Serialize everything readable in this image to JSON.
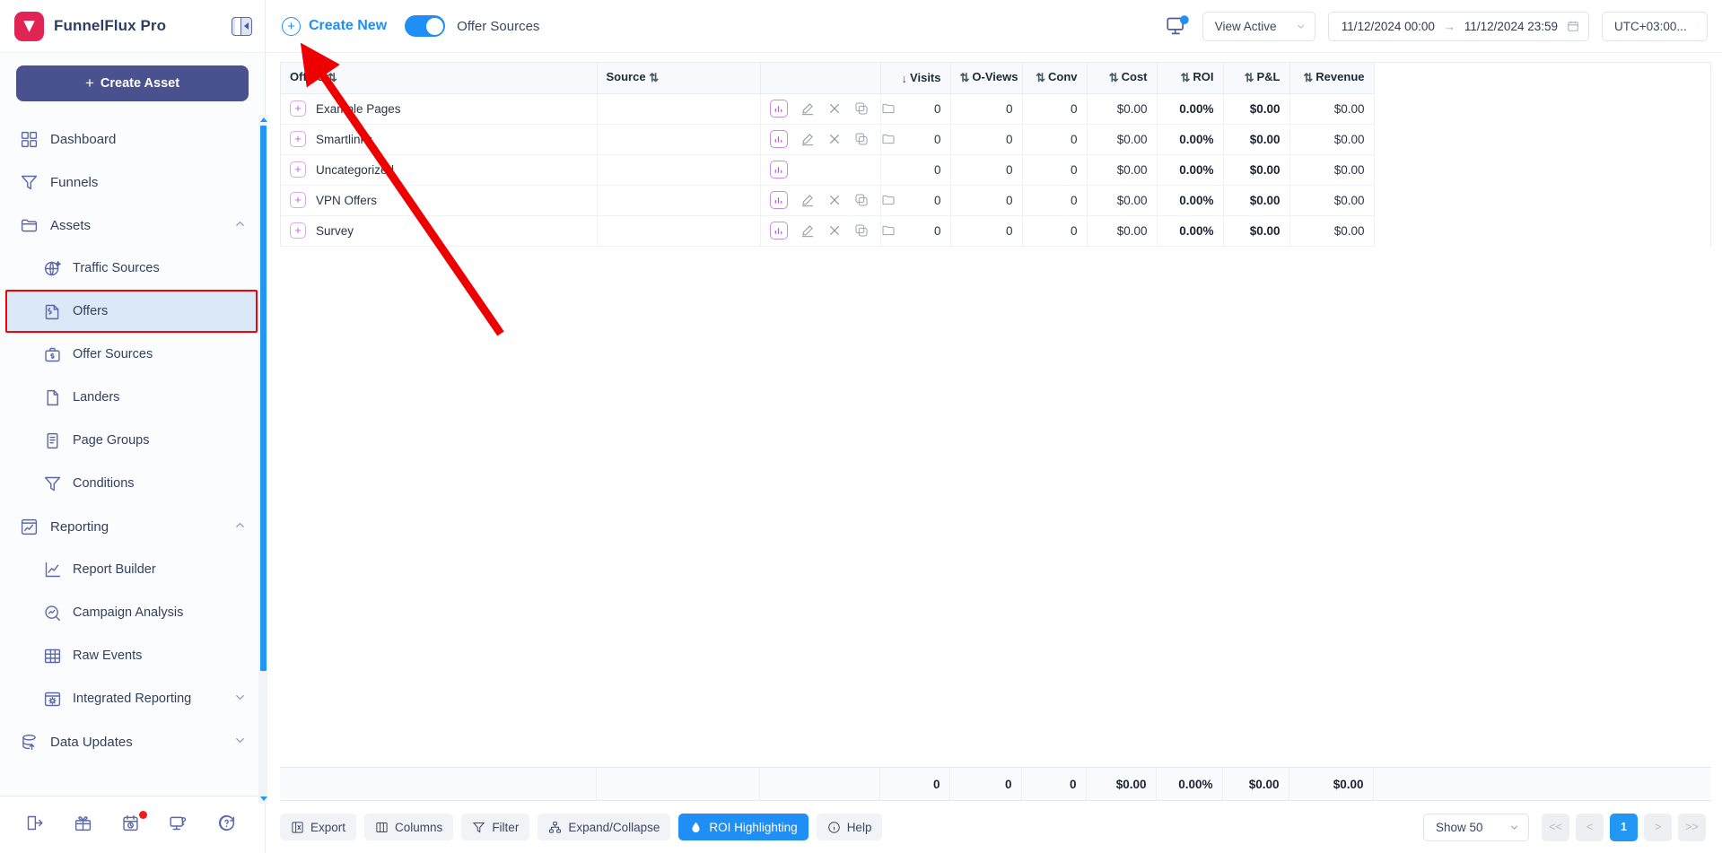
{
  "app": {
    "brand_title": "FunnelFlux Pro",
    "collapse_icon": "panel-collapse-icon",
    "create_asset_label": "Create Asset"
  },
  "sidebar": {
    "items": [
      {
        "label": "Dashboard",
        "icon": "dashboard-grid-icon",
        "level": "top",
        "active": false,
        "chevron": false
      },
      {
        "label": "Funnels",
        "icon": "funnel-icon",
        "level": "top",
        "active": false,
        "chevron": false
      },
      {
        "label": "Assets",
        "icon": "folder-icon",
        "level": "top",
        "active": false,
        "chevron": true
      },
      {
        "label": "Traffic Sources",
        "icon": "globe-sparkle-icon",
        "level": "sub",
        "active": false,
        "chevron": false
      },
      {
        "label": "Offers",
        "icon": "offer-dollar-doc-icon",
        "level": "sub",
        "active": true,
        "chevron": false
      },
      {
        "label": "Offer Sources",
        "icon": "briefcase-dollar-icon",
        "level": "sub",
        "active": false,
        "chevron": false
      },
      {
        "label": "Landers",
        "icon": "page-icon",
        "level": "sub",
        "active": false,
        "chevron": false
      },
      {
        "label": "Page Groups",
        "icon": "page-stack-icon",
        "level": "sub",
        "active": false,
        "chevron": false
      },
      {
        "label": "Conditions",
        "icon": "filter-funnel-icon",
        "level": "sub",
        "active": false,
        "chevron": false
      },
      {
        "label": "Reporting",
        "icon": "report-chart-icon",
        "level": "top",
        "active": false,
        "chevron": true
      },
      {
        "label": "Report Builder",
        "icon": "line-chart-icon",
        "level": "sub",
        "active": false,
        "chevron": false
      },
      {
        "label": "Campaign Analysis",
        "icon": "magnifier-chart-icon",
        "level": "sub",
        "active": false,
        "chevron": false
      },
      {
        "label": "Raw Events",
        "icon": "table-grid-icon",
        "level": "sub",
        "active": false,
        "chevron": false
      },
      {
        "label": "Integrated Reporting",
        "icon": "window-gear-icon",
        "level": "sub",
        "active": false,
        "chevron": true
      },
      {
        "label": "Data Updates",
        "icon": "database-upload-icon",
        "level": "top",
        "active": false,
        "chevron": true
      }
    ],
    "footer_icons": [
      {
        "name": "logout-icon",
        "badge": false
      },
      {
        "name": "gift-icon",
        "badge": false
      },
      {
        "name": "calendar-clock-icon",
        "badge": true
      },
      {
        "name": "monitor-question-icon",
        "badge": false
      },
      {
        "name": "help-chat-icon",
        "badge": false
      }
    ],
    "active_highlight_color": "#fa0000"
  },
  "topbar": {
    "create_new_label": "Create New",
    "create_new_icon": "plus-circle-icon",
    "toggle_label": "Offer Sources",
    "toggle_on": true,
    "monitor_icon": "monitor-refresh-icon",
    "view_select": "View Active",
    "date_from": "11/12/2024 00:00",
    "date_arrow": "→",
    "date_to": "11/12/2024 23:59",
    "calendar_icon": "calendar-icon",
    "timezone": "UTC+03:00..."
  },
  "table": {
    "columns": [
      {
        "key": "offers",
        "label": "Offers",
        "align": "left",
        "sort": "none"
      },
      {
        "key": "source",
        "label": "Source",
        "align": "left",
        "sort": "none"
      },
      {
        "key": "actions",
        "label": "",
        "align": "left",
        "sort": null
      },
      {
        "key": "visits",
        "label": "Visits",
        "align": "right",
        "sort": "desc"
      },
      {
        "key": "oviews",
        "label": "O-Views",
        "align": "right",
        "sort": "none"
      },
      {
        "key": "conv",
        "label": "Conv",
        "align": "right",
        "sort": "none"
      },
      {
        "key": "cost",
        "label": "Cost",
        "align": "right",
        "sort": "none"
      },
      {
        "key": "roi",
        "label": "ROI",
        "align": "right",
        "sort": "none"
      },
      {
        "key": "pl",
        "label": "P&L",
        "align": "right",
        "sort": "none"
      },
      {
        "key": "revenue",
        "label": "Revenue",
        "align": "right",
        "sort": "none"
      }
    ],
    "rows": [
      {
        "name": "Example Pages",
        "source": "",
        "has_actions": true,
        "visits": "0",
        "oviews": "0",
        "conv": "0",
        "cost": "$0.00",
        "roi": "0.00%",
        "pl": "$0.00",
        "revenue": "$0.00"
      },
      {
        "name": "Smartlinks",
        "source": "",
        "has_actions": true,
        "visits": "0",
        "oviews": "0",
        "conv": "0",
        "cost": "$0.00",
        "roi": "0.00%",
        "pl": "$0.00",
        "revenue": "$0.00"
      },
      {
        "name": "Uncategorized",
        "source": "",
        "has_actions": false,
        "visits": "0",
        "oviews": "0",
        "conv": "0",
        "cost": "$0.00",
        "roi": "0.00%",
        "pl": "$0.00",
        "revenue": "$0.00"
      },
      {
        "name": "VPN Offers",
        "source": "",
        "has_actions": true,
        "visits": "0",
        "oviews": "0",
        "conv": "0",
        "cost": "$0.00",
        "roi": "0.00%",
        "pl": "$0.00",
        "revenue": "$0.00"
      },
      {
        "name": "Survey",
        "source": "",
        "has_actions": true,
        "visits": "0",
        "oviews": "0",
        "conv": "0",
        "cost": "$0.00",
        "roi": "0.00%",
        "pl": "$0.00",
        "revenue": "$0.00"
      }
    ],
    "totals": {
      "visits": "0",
      "oviews": "0",
      "conv": "0",
      "cost": "$0.00",
      "roi": "0.00%",
      "pl": "$0.00",
      "revenue": "$0.00"
    },
    "row_action_icons": [
      "chart-bar-icon",
      "edit-pencil-icon",
      "delete-x-icon",
      "duplicate-copy-icon",
      "archive-folder-icon"
    ],
    "expand_icon": "expand-plus-icon"
  },
  "bottombar": {
    "buttons": [
      {
        "label": "Export",
        "icon": "export-excel-icon",
        "primary": false
      },
      {
        "label": "Columns",
        "icon": "columns-icon",
        "primary": false
      },
      {
        "label": "Filter",
        "icon": "filter-icon",
        "primary": false
      },
      {
        "label": "Expand/Collapse",
        "icon": "hierarchy-icon",
        "primary": false
      },
      {
        "label": "ROI Highlighting",
        "icon": "droplet-icon",
        "primary": true
      },
      {
        "label": "Help",
        "icon": "info-circle-icon",
        "primary": false
      }
    ],
    "page_size": "Show 50",
    "pager": [
      {
        "label": "<<",
        "current": false
      },
      {
        "label": "<",
        "current": false
      },
      {
        "label": "1",
        "current": true
      },
      {
        "label": ">",
        "current": false
      },
      {
        "label": ">>",
        "current": false
      }
    ]
  },
  "annotation": {
    "type": "arrow",
    "color": "#ef0000",
    "points_to": "create-new-button"
  }
}
